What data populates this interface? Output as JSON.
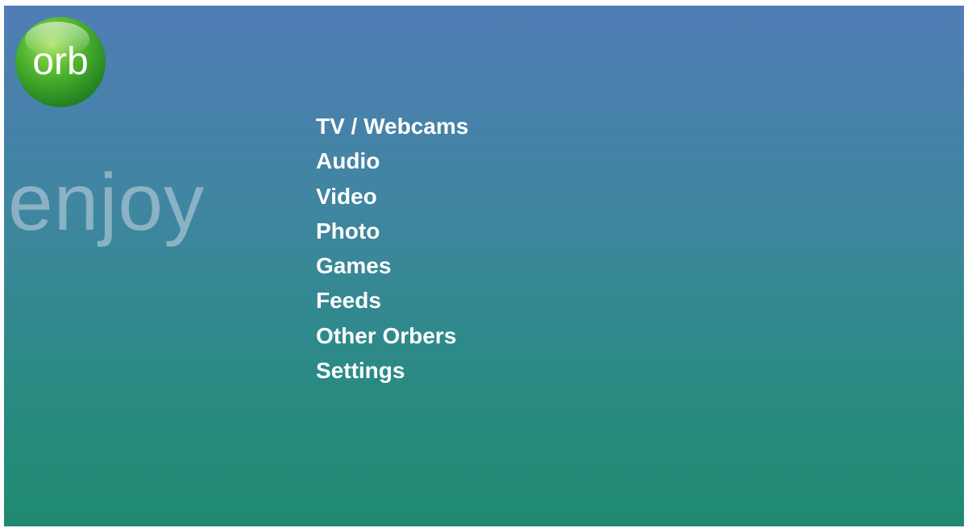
{
  "logo": {
    "text": "orb",
    "icon": "orb-logo-icon",
    "color": "#2e9a2a"
  },
  "tagline": "enjoy",
  "menu": {
    "items": [
      {
        "label": "TV / Webcams"
      },
      {
        "label": "Audio"
      },
      {
        "label": "Video"
      },
      {
        "label": "Photo"
      },
      {
        "label": "Games"
      },
      {
        "label": "Feeds"
      },
      {
        "label": "Other Orbers"
      },
      {
        "label": "Settings"
      }
    ]
  },
  "colors": {
    "background_top": "#507db5",
    "background_bottom": "#1f8a70",
    "menu_text": "#ffffff",
    "tagline_text": "#c8d7e1"
  }
}
